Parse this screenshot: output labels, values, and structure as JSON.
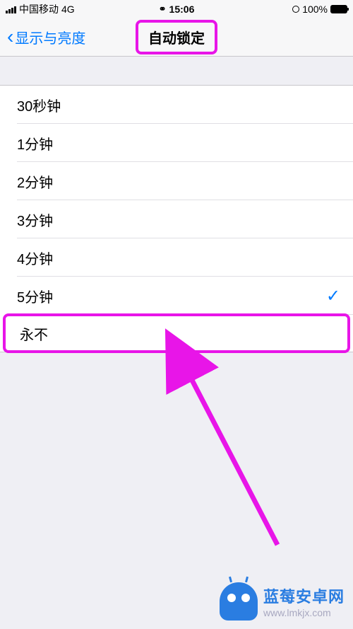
{
  "status_bar": {
    "carrier": "中国移动",
    "network": "4G",
    "time": "15:06",
    "battery_percent": "100%"
  },
  "nav": {
    "back_label": "显示与亮度",
    "title": "自动锁定"
  },
  "options": [
    {
      "label": "30秒钟",
      "selected": false
    },
    {
      "label": "1分钟",
      "selected": false
    },
    {
      "label": "2分钟",
      "selected": false
    },
    {
      "label": "3分钟",
      "selected": false
    },
    {
      "label": "4分钟",
      "selected": false
    },
    {
      "label": "5分钟",
      "selected": true
    },
    {
      "label": "永不",
      "selected": false
    }
  ],
  "highlight_index": 6,
  "watermark": {
    "line1": "蓝莓安卓网",
    "line2": "www.lmkjx.com"
  },
  "colors": {
    "accent": "#007aff",
    "highlight": "#e815e8",
    "brand": "#2a7de1"
  }
}
